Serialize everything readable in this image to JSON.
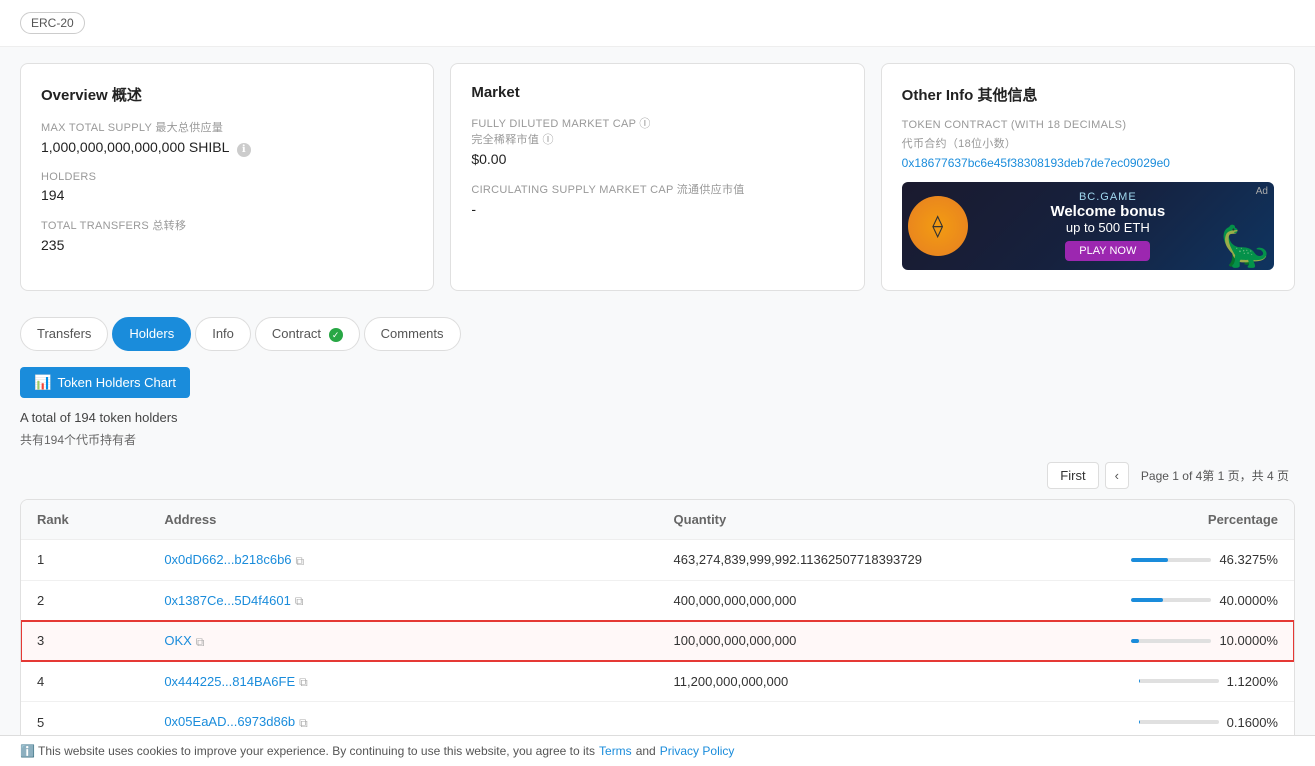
{
  "badge": "ERC-20",
  "overview": {
    "title": "Overview 概述",
    "fields": [
      {
        "label": "MAX TOTAL SUPPLY 最大总供应量",
        "value": "1,000,000,000,000,000 SHIBL",
        "info": true
      },
      {
        "label": "HOLDERS",
        "value": "194"
      },
      {
        "label": "TOTAL TRANSFERS 总转移",
        "value": "235"
      }
    ]
  },
  "market": {
    "title": "Market",
    "fields": [
      {
        "label": "FULLY DILUTED MARKET CAP ⓘ 完全稀释市值 ⓘ",
        "value": "$0.00"
      },
      {
        "label": "CIRCULATING SUPPLY MARKET CAP 流通供应市值",
        "value": "-"
      }
    ]
  },
  "other_info": {
    "title": "Other Info 其他信息",
    "contract_label": "TOKEN CONTRACT (WITH 18 DECIMALS)",
    "contract_label_cn": "代币合约（18位小数）",
    "contract_address": "0x18677637bc6e45f38308193deb7de7ec09029e0",
    "ad_label": "Ad",
    "ad_brand": "BC.GAME",
    "ad_headline": "Welcome bonus",
    "ad_sub": "up to 500 ETH",
    "ad_btn": "PLAY NOW"
  },
  "tabs": [
    {
      "id": "transfers",
      "label": "Transfers",
      "active": false,
      "verified": false
    },
    {
      "id": "holders",
      "label": "Holders",
      "active": true,
      "verified": false
    },
    {
      "id": "info",
      "label": "Info",
      "active": false,
      "verified": false
    },
    {
      "id": "contract",
      "label": "Contract",
      "active": false,
      "verified": true
    },
    {
      "id": "comments",
      "label": "Comments",
      "active": false,
      "verified": false
    }
  ],
  "holders_section": {
    "chart_btn": "Token Holders Chart",
    "total_text": "A total of 194 token holders",
    "total_cn": "共有194个代币持有者",
    "pagination": {
      "first": "First",
      "page_info": "Page 1 of 4第 1 页，共 4 页"
    }
  },
  "table": {
    "headers": [
      "Rank",
      "Address",
      "Quantity",
      "Percentage"
    ],
    "rows": [
      {
        "rank": "1",
        "address": "0x0dD662...b218c6b6",
        "quantity": "463,274,839,999,992.11362507718393729",
        "percentage": 46.3275,
        "pct_text": "46.3275%",
        "highlighted": false
      },
      {
        "rank": "2",
        "address": "0x1387Ce...5D4f4601",
        "quantity": "400,000,000,000,000",
        "percentage": 40.0,
        "pct_text": "40.0000%",
        "highlighted": false
      },
      {
        "rank": "3",
        "address": "OKX",
        "quantity": "100,000,000,000,000",
        "percentage": 10.0,
        "pct_text": "10.0000%",
        "highlighted": true
      },
      {
        "rank": "4",
        "address": "0x444225...814BA6FE",
        "quantity": "11,200,000,000,000",
        "percentage": 1.12,
        "pct_text": "1.1200%",
        "highlighted": false
      },
      {
        "rank": "5",
        "address": "0x05EaAD...6973d86b",
        "quantity": "",
        "percentage": 0.16,
        "pct_text": "0.1600%",
        "highlighted": false
      }
    ]
  },
  "cookie_bar": {
    "text": "This website uses cookies to improve your experience. By continuing to use this website, you agree to its",
    "terms": "Terms",
    "and": "and",
    "privacy": "Privacy Policy"
  }
}
